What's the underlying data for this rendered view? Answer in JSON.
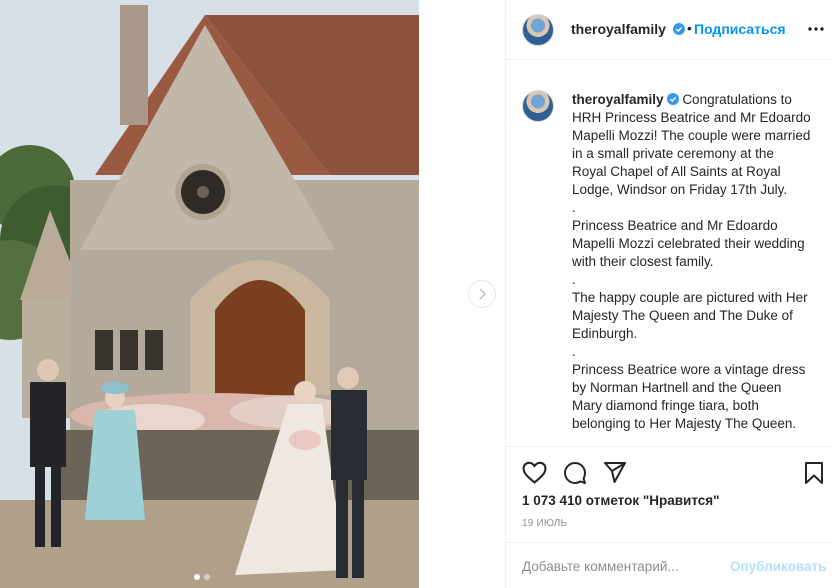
{
  "post": {
    "image_alt": "Princess Beatrice and Mr Edoardo Mapelli Mozzi with The Queen and The Duke of Edinburgh outside the Royal Chapel of All Saints",
    "carousel": {
      "slide_count": 2,
      "active_index": 0
    }
  },
  "header": {
    "username": "theroyalfamily",
    "separator": "•",
    "follow_label": "Подписаться",
    "more_icon": "more-horizontal-icon"
  },
  "caption": {
    "username": "theroyalfamily",
    "paragraphs": [
      "Congratulations to HRH Princess Beatrice and Mr Edoardo Mapelli Mozzi! The couple were married in a small private ceremony at the Royal Chapel of All Saints at Royal Lodge, Windsor on Friday 17th July.",
      ".",
      "Princess Beatrice and Mr Edoardo Mapelli Mozzi celebrated their wedding with their closest family.",
      ".",
      "The happy couple are pictured with Her Majesty The Queen and The Duke of Edinburgh.",
      ".",
      "Princess Beatrice wore a vintage dress by Norman Hartnell and the Queen Mary diamond fringe tiara, both belonging to Her Majesty The Queen."
    ]
  },
  "actions": {
    "icons": [
      "heart-icon",
      "comment-icon",
      "share-icon",
      "bookmark-icon"
    ],
    "likes_text": "1 073 410 отметок \"Нравится\"",
    "date_text": "19 ИЮЛЬ"
  },
  "comment_box": {
    "placeholder": "Добавьте комментарий...",
    "publish_label": "Опубликовать"
  },
  "colors": {
    "accent": "#0095f6",
    "publish_disabled": "#b2dffc",
    "muted": "#8e8e8e",
    "border": "#efefef"
  }
}
